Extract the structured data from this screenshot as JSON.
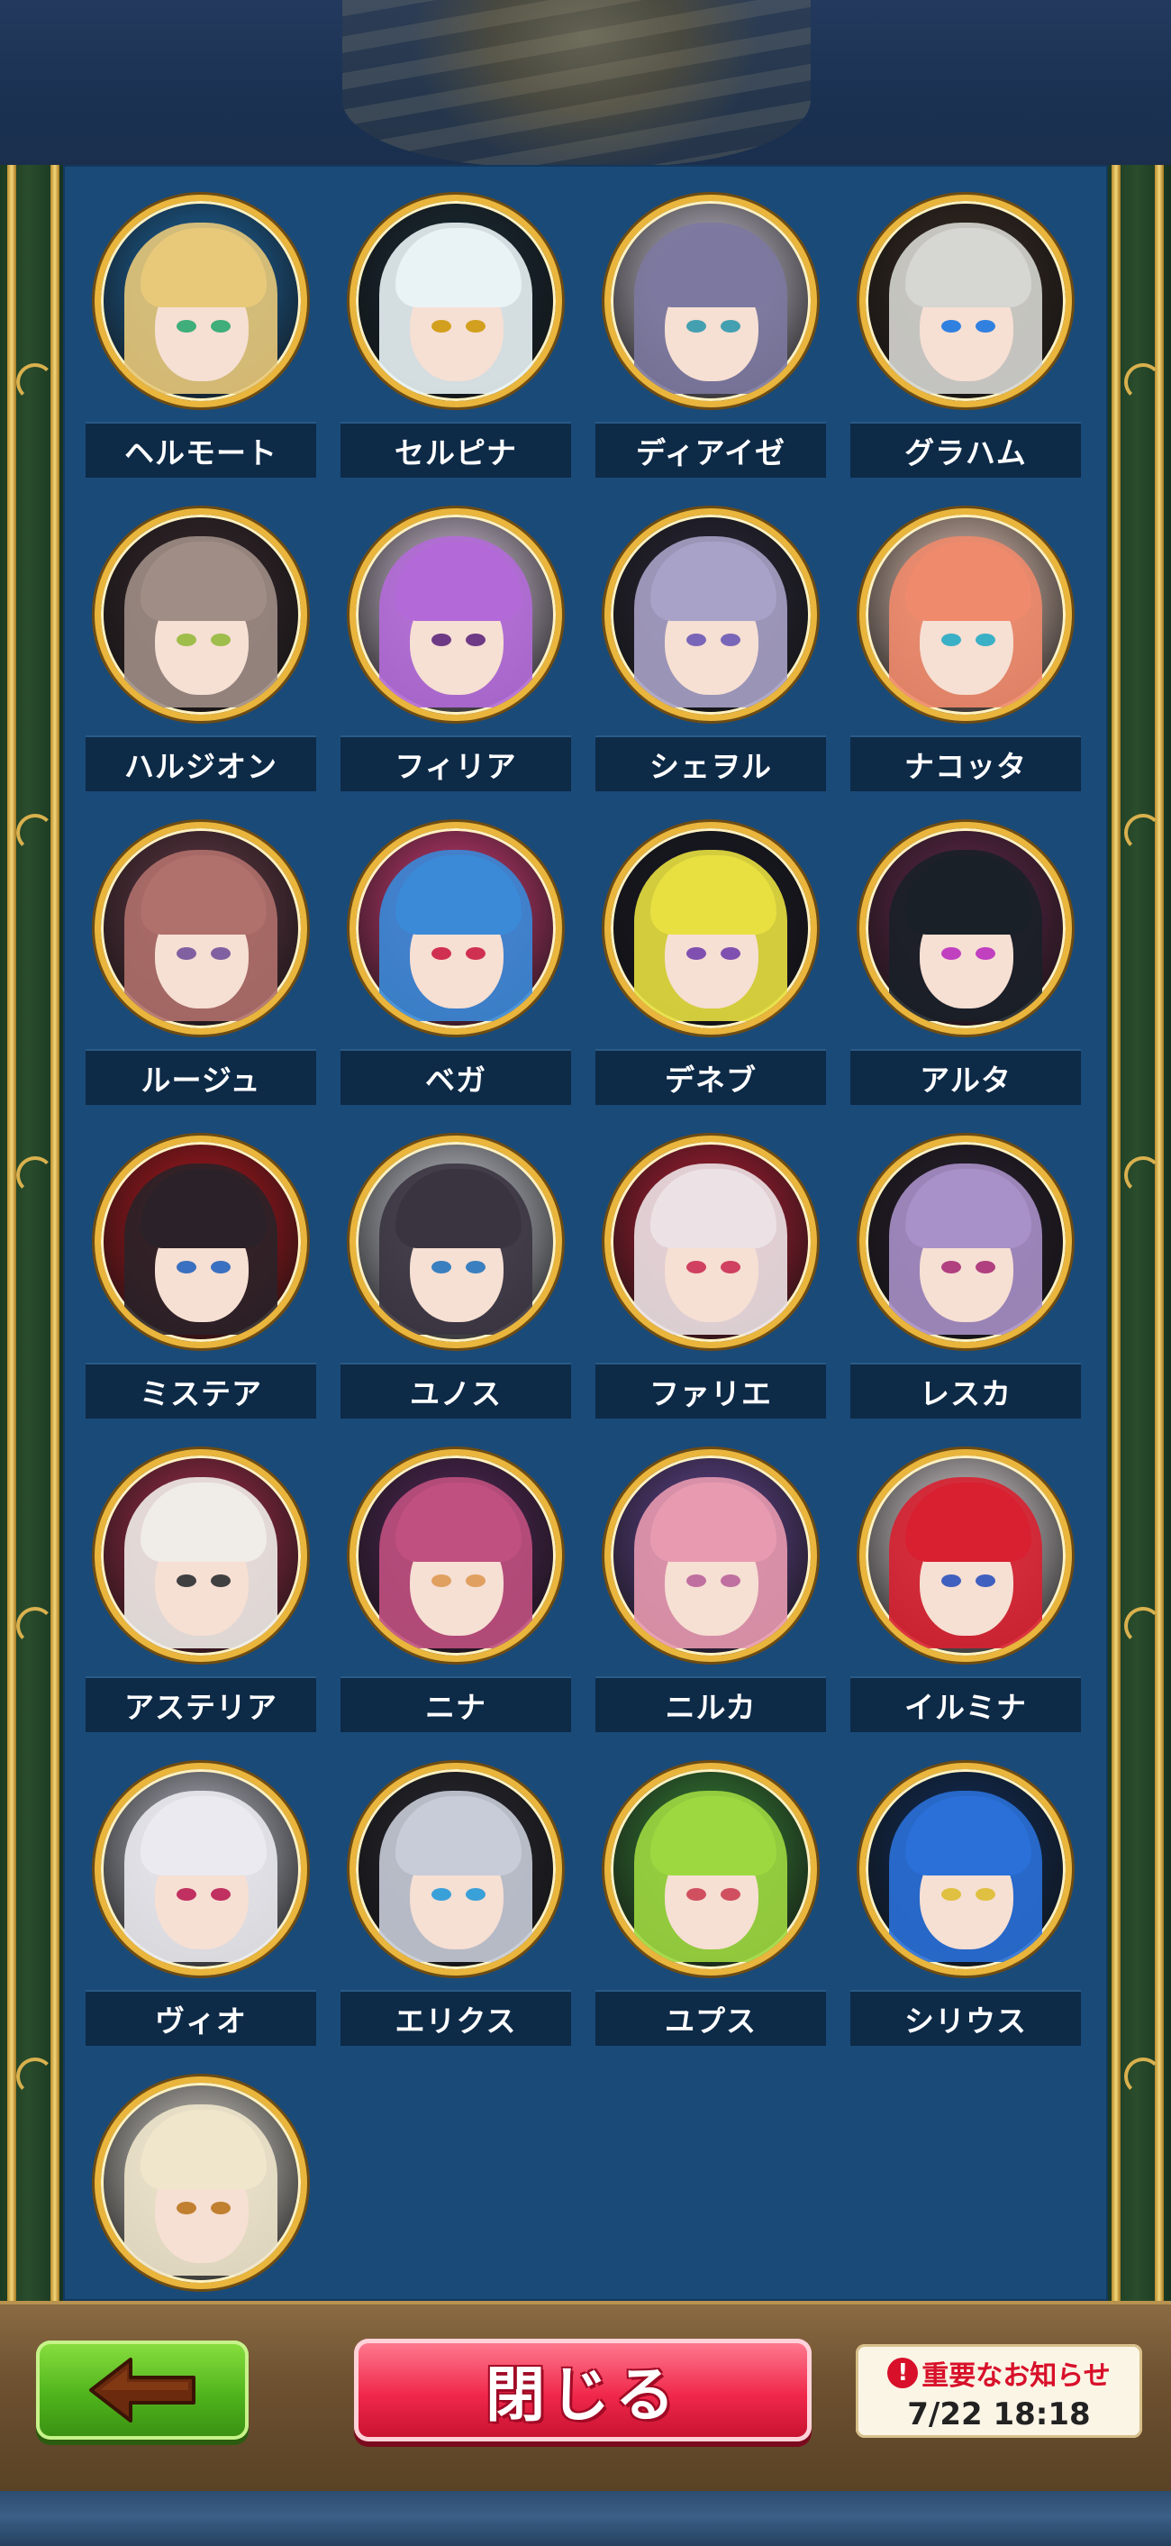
{
  "characters": [
    {
      "name": "ヘルモート",
      "hair": "#e8c97a",
      "bg": "#1f6fb0",
      "eye": "#3fae7a"
    },
    {
      "name": "セルピナ",
      "hair": "#e9f3f5",
      "bg": "#1a2e3a",
      "eye": "#d2a01e"
    },
    {
      "name": "ディアイゼ",
      "hair": "#7c78a0",
      "bg": "#d8d2e2",
      "eye": "#44a0b0"
    },
    {
      "name": "グラハム",
      "hair": "#d6d6d2",
      "bg": "#3a2c24",
      "eye": "#3080e0"
    },
    {
      "name": "ハルジオン",
      "hair": "#a08e86",
      "bg": "#3a2a30",
      "eye": "#9ebd4a"
    },
    {
      "name": "フィリア",
      "hair": "#b36ad8",
      "bg": "#e8d8ee",
      "eye": "#6e3a86"
    },
    {
      "name": "シェヲル",
      "hair": "#a9a2c8",
      "bg": "#2c2a3c",
      "eye": "#7a66b8"
    },
    {
      "name": "ナコッタ",
      "hair": "#f08a6c",
      "bg": "#f6d6c6",
      "eye": "#3ab0c6"
    },
    {
      "name": "ルージュ",
      "hair": "#b0706c",
      "bg": "#6a3c4a",
      "eye": "#8060a0"
    },
    {
      "name": "ベガ",
      "hair": "#3a8ad8",
      "bg": "#e04080",
      "eye": "#d03050"
    },
    {
      "name": "デネブ",
      "hair": "#e8e040",
      "bg": "#1a1a28",
      "eye": "#8050b0"
    },
    {
      "name": "アルタ",
      "hair": "#1a2028",
      "bg": "#6a2a50",
      "eye": "#c040c0"
    },
    {
      "name": "ミステア",
      "hair": "#2a2228",
      "bg": "#c01820",
      "eye": "#3a70c0"
    },
    {
      "name": "ユノス",
      "hair": "#3a3440",
      "bg": "#d8dce6",
      "eye": "#3a80c0"
    },
    {
      "name": "ファリエ",
      "hair": "#ece2e6",
      "bg": "#c02038",
      "eye": "#d04060"
    },
    {
      "name": "レスカ",
      "hair": "#a890c8",
      "bg": "#2a2030",
      "eye": "#b04080"
    },
    {
      "name": "アステリア",
      "hair": "#f0ece8",
      "bg": "#b03050",
      "eye": "#404040"
    },
    {
      "name": "ニナ",
      "hair": "#c05080",
      "bg": "#5a2a60",
      "eye": "#e0a060"
    },
    {
      "name": "ニルカ",
      "hair": "#e89ab0",
      "bg": "#6a4a9a",
      "eye": "#c070a0"
    },
    {
      "name": "イルミナ",
      "hair": "#d82030",
      "bg": "#f0e8ea",
      "eye": "#4060c0"
    },
    {
      "name": "ヴィオ",
      "hair": "#eaeaf0",
      "bg": "#c8cad6",
      "eye": "#c03060"
    },
    {
      "name": "エリクス",
      "hair": "#c8ccd8",
      "bg": "#2a2a34",
      "eye": "#3aa0d8"
    },
    {
      "name": "ユプス",
      "hair": "#9ed840",
      "bg": "#3a8a3a",
      "eye": "#d05060"
    },
    {
      "name": "シリウス",
      "hair": "#2a70d8",
      "bg": "#103060",
      "eye": "#e0c040"
    },
    {
      "name": "",
      "hair": "#f0e6cc",
      "bg": "#e6e2da",
      "eye": "#c08030"
    }
  ],
  "footer": {
    "back_icon": "left-arrow-icon",
    "close_label": "閉じる",
    "notice_label": "重要なお知らせ",
    "notice_datetime": "7/22 18:18",
    "notice_icon": "!"
  }
}
